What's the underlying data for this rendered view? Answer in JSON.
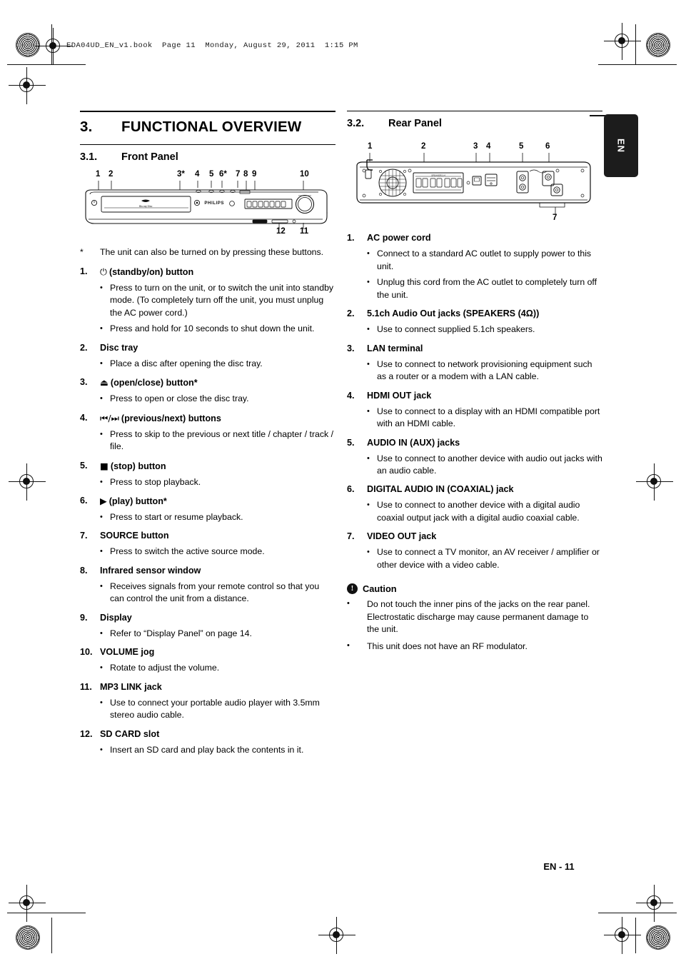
{
  "print": {
    "file_header": "EDA04UD_EN_v1.book  Page 11  Monday, August 29, 2011  1:15 PM"
  },
  "side_tab": {
    "label": "EN"
  },
  "footer": {
    "page_label": "EN - 11"
  },
  "chapter": {
    "number": "3.",
    "title": "FUNCTIONAL OVERVIEW"
  },
  "left_column": {
    "section": {
      "number": "3.1.",
      "title": "Front Panel"
    },
    "figure": {
      "name": "front-panel-diagram",
      "brand": "PHILIPS",
      "top_callouts": [
        "1",
        "2",
        "3*",
        "4",
        "5",
        "6*",
        "7",
        "8",
        "9",
        "10"
      ],
      "bottom_callouts": [
        "12",
        "11"
      ]
    },
    "star_note": {
      "marker": "*",
      "text": "The unit can also be turned on by pressing these buttons."
    },
    "items": [
      {
        "num": "1.",
        "glyph": "⏻",
        "title": "(standby/on) button",
        "bullets": [
          "Press to turn on the unit, or to switch the unit into standby mode. (To completely turn off the unit, you must unplug the AC power cord.)",
          "Press and hold for 10 seconds to shut down the unit."
        ]
      },
      {
        "num": "2.",
        "glyph": "",
        "title": "Disc tray",
        "bullets": [
          "Place a disc after opening the disc tray."
        ]
      },
      {
        "num": "3.",
        "glyph": "⏏",
        "title": "(open/close) button*",
        "bullets": [
          "Press to open or close the disc tray."
        ]
      },
      {
        "num": "4.",
        "glyph": "⏮/⏭",
        "title": "(previous/next) buttons",
        "bullets": [
          "Press to skip to the previous or next title / chapter / track / file."
        ]
      },
      {
        "num": "5.",
        "glyph": "■",
        "title": "(stop) button",
        "bullets": [
          "Press to stop playback."
        ]
      },
      {
        "num": "6.",
        "glyph": "▶",
        "title": "(play) button*",
        "bullets": [
          "Press to start or resume playback."
        ]
      },
      {
        "num": "7.",
        "glyph": "",
        "title": "SOURCE button",
        "bullets": [
          "Press to switch the active source mode."
        ]
      },
      {
        "num": "8.",
        "glyph": "",
        "title": "Infrared sensor window",
        "bullets": [
          "Receives signals from your remote control so that you can control the unit from a distance."
        ]
      },
      {
        "num": "9.",
        "glyph": "",
        "title": "Display",
        "bullets": [
          "Refer to “Display Panel” on page 14."
        ]
      },
      {
        "num": "10.",
        "glyph": "",
        "title": "VOLUME jog",
        "bullets": [
          "Rotate to adjust the volume."
        ]
      },
      {
        "num": "11.",
        "glyph": "",
        "title": "MP3 LINK jack",
        "bullets": [
          "Use to connect your portable audio player with 3.5mm stereo audio cable."
        ]
      },
      {
        "num": "12.",
        "glyph": "",
        "title": "SD CARD slot",
        "bullets": [
          "Insert an SD card and play back the contents in it."
        ]
      }
    ]
  },
  "right_column": {
    "section": {
      "number": "3.2.",
      "title": "Rear Panel"
    },
    "figure": {
      "name": "rear-panel-diagram",
      "top_callouts": [
        "1",
        "2",
        "3",
        "4",
        "5",
        "6"
      ],
      "bottom_callouts": [
        "7"
      ]
    },
    "items": [
      {
        "num": "1.",
        "glyph": "",
        "title": "AC power cord",
        "bullets": [
          "Connect to a standard AC outlet to supply power to this unit.",
          "Unplug this cord from the AC outlet to completely turn off the unit."
        ]
      },
      {
        "num": "2.",
        "glyph": "",
        "title": "5.1ch Audio Out jacks (SPEAKERS (4Ω))",
        "bullets": [
          "Use to connect supplied 5.1ch speakers."
        ]
      },
      {
        "num": "3.",
        "glyph": "",
        "title": "LAN terminal",
        "bullets": [
          "Use to connect to network provisioning equipment such as a router or a modem with a LAN cable."
        ]
      },
      {
        "num": "4.",
        "glyph": "",
        "title": "HDMI OUT jack",
        "bullets": [
          "Use to connect to a display with an HDMI compatible port with an HDMI cable."
        ]
      },
      {
        "num": "5.",
        "glyph": "",
        "title": "AUDIO IN (AUX) jacks",
        "bullets": [
          "Use to connect to another device with audio out jacks with an audio cable."
        ]
      },
      {
        "num": "6.",
        "glyph": "",
        "title": "DIGITAL AUDIO IN (COAXIAL) jack",
        "bullets": [
          "Use to connect to another device with a digital audio coaxial output jack with a digital audio coaxial cable."
        ]
      },
      {
        "num": "7.",
        "glyph": "",
        "title": "VIDEO OUT jack",
        "bullets": [
          "Use to connect a TV monitor, an AV receiver / amplifier or other device with a video cable."
        ]
      }
    ],
    "caution": {
      "icon": "!",
      "title": "Caution",
      "bullets": [
        "Do not touch the inner pins of the jacks on the rear panel. Electrostatic discharge may cause permanent damage to the unit.",
        "This unit does not have an RF modulator."
      ]
    }
  }
}
